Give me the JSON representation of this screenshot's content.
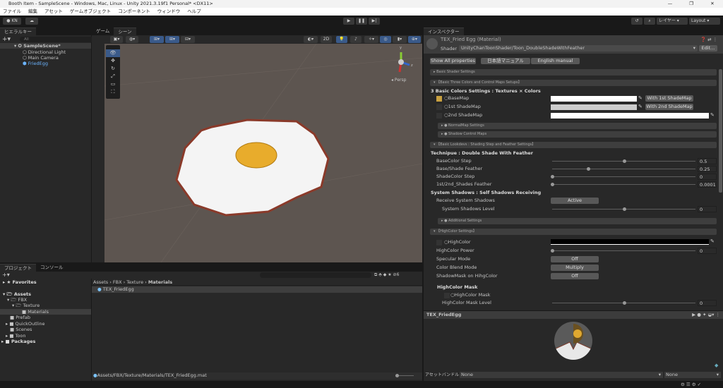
{
  "window": {
    "title": "Booth Item - SampleScene - Windows, Mac, Linux - Unity 2021.3.19f1 Personal* <DX11>",
    "controls": [
      "—",
      "❐",
      "✕"
    ]
  },
  "menu": [
    "ファイル",
    "編集",
    "アセット",
    "ゲームオブジェクト",
    "コンポーネント",
    "ウィンドウ",
    "ヘルプ"
  ],
  "toolbar": {
    "account": "KN ▾",
    "layers": "レイヤー",
    "layout": "Layout",
    "play": "▶",
    "pause": "❚❚",
    "step": "▶|"
  },
  "hierarchy": {
    "tab": "ヒエラルキー",
    "search_placeholder": "All",
    "scene": "SampleScene*",
    "items": [
      "Directional Light",
      "Main Camera",
      "FriedEgg"
    ]
  },
  "scene": {
    "tabs": [
      "ゲーム",
      "シーン"
    ],
    "mode_2d": "2D",
    "persp": "◂ Persp",
    "gizmo_y": "y",
    "gizmo_z": "z"
  },
  "project": {
    "tabs": [
      "プロジェクト",
      "コンソール"
    ],
    "favorites": "Favorites",
    "tree": [
      "Assets",
      "FBX",
      "Texture",
      "Materials",
      "Prefab",
      "QuickOutline",
      "Scenes",
      "Toon",
      "Packages"
    ],
    "breadcrumb": [
      "Assets",
      "FBX",
      "Texture",
      "Materials"
    ],
    "files": [
      "TEX_FriedEgg"
    ],
    "path": "Assets/FBX/Texture/Materials/TEX_FriedEgg.mat",
    "hidden_count": "6"
  },
  "inspector": {
    "tab": "インスペクター",
    "title": "TEX_Fried Egg (Material)",
    "shader_label": "Shader",
    "shader": "UnityChanToonShader/Toon_DoubleShadeWithFeather",
    "edit": "Edit...",
    "buttons": [
      "Show All properties",
      "日本語マニュアル",
      "English manual"
    ],
    "sections": {
      "basic_shader": "Basic Shader Settings",
      "three_colors": "【Basic Three Colors and Control Maps Setups】",
      "normalmap": "● NormalMap Settings",
      "shadow_control": "● Shadow Control Maps",
      "lookdevs": "【Basic Lookdevs : Shading Step and Feather Settings】",
      "additional": "● Additional Settings",
      "highcolor": "【HighColor Settings】"
    },
    "colors_heading": "3 Basic Colors Settings : Textures × Colors",
    "basemap": "○BaseMap",
    "shade1": "○1st ShadeMap",
    "shade2": "○2nd ShadeMap",
    "with1": "With 1st ShadeMap",
    "with2": "With 2nd ShadeMap",
    "technique": "Technipue : Double Shade With Feather",
    "sliders": [
      {
        "label": "BaseColor Step",
        "value": "0.5",
        "fraction": 0.5
      },
      {
        "label": "Base/Shade Feather",
        "value": "0.25",
        "fraction": 0.25
      },
      {
        "label": "ShadeColor Step",
        "value": "0",
        "fraction": 0
      },
      {
        "label": "1st/2nd_Shades Feather",
        "value": "0.0001",
        "fraction": 0
      }
    ],
    "shadows_heading": "System Shadows : Self Shadows Receiving",
    "receive": "Receive System Shadows",
    "receive_value": "Active",
    "shadow_level": {
      "label": "System Shadows Level",
      "value": "0",
      "fraction": 0.5
    },
    "highcolor": "○HighColor",
    "highcolor_power": {
      "label": "HighColor Power",
      "value": "0",
      "fraction": 0
    },
    "specular": {
      "label": "Specular Mode",
      "value": "Off"
    },
    "blend": {
      "label": "Color Blend Mode",
      "value": "Multiply"
    },
    "shadowmask": {
      "label": "ShadowMask on HihgColor",
      "value": "Off"
    },
    "mask_heading": "HighColor Mask",
    "mask": "○HighColor Mask",
    "mask_level": {
      "label": "HighColor Mask Level",
      "value": "0",
      "fraction": 0.5
    },
    "colors": {
      "basemap": "#ffffff",
      "shade1": "#cccccc",
      "shade2": "#ffffff",
      "highcolor": "#000000"
    }
  },
  "preview": {
    "title": "TEX_FriedEgg"
  },
  "asset_bundle": {
    "label": "アセットバンドル",
    "value1": "None",
    "value2": "None"
  }
}
